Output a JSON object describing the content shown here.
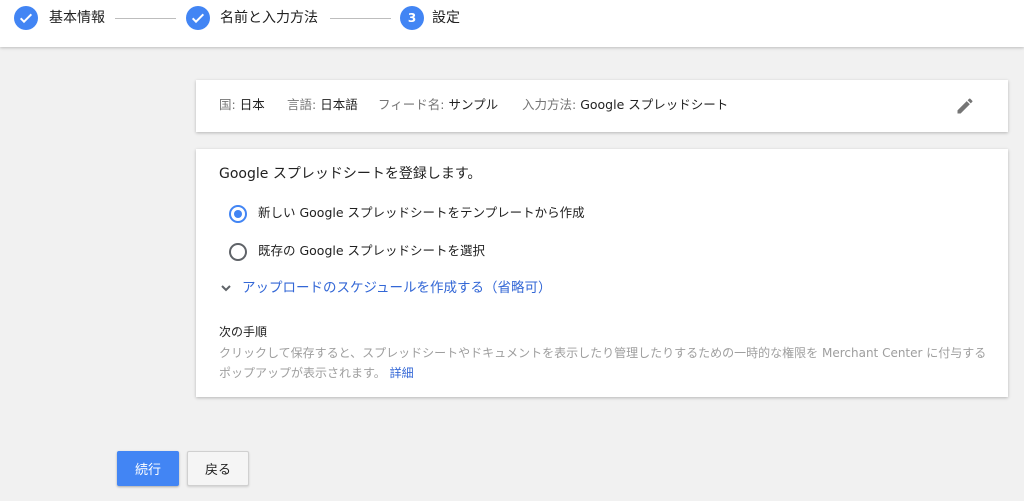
{
  "stepper": {
    "steps": [
      {
        "label": "基本情報",
        "state": "done"
      },
      {
        "label": "名前と入力方法",
        "state": "done"
      },
      {
        "label": "設定",
        "state": "current",
        "number": "3"
      }
    ]
  },
  "summary": {
    "country_label": "国:",
    "country_value": "日本",
    "language_label": "言語:",
    "language_value": "日本語",
    "feed_label": "フィード名:",
    "feed_value": "サンプル",
    "input_label": "入力方法:",
    "input_value": "Google スプレッドシート",
    "edit_icon": "pencil-icon"
  },
  "main": {
    "title": "Google スプレッドシートを登録します。",
    "options": [
      {
        "label": "新しい Google スプレッドシートをテンプレートから作成",
        "selected": true
      },
      {
        "label": "既存の Google スプレッドシートを選択",
        "selected": false
      }
    ],
    "schedule_link": "アップロードのスケジュールを作成する（省略可）",
    "next_steps_title": "次の手順",
    "next_steps_desc": "クリックして保存すると、スプレッドシートやドキュメントを表示したり管理したりするための一時的な権限を Merchant Center に付与するポップアップが表示されます。",
    "detail_link": "詳細"
  },
  "buttons": {
    "continue": "続行",
    "back": "戻る"
  },
  "colors": {
    "accent": "#4285f4",
    "link": "#3367d6"
  }
}
